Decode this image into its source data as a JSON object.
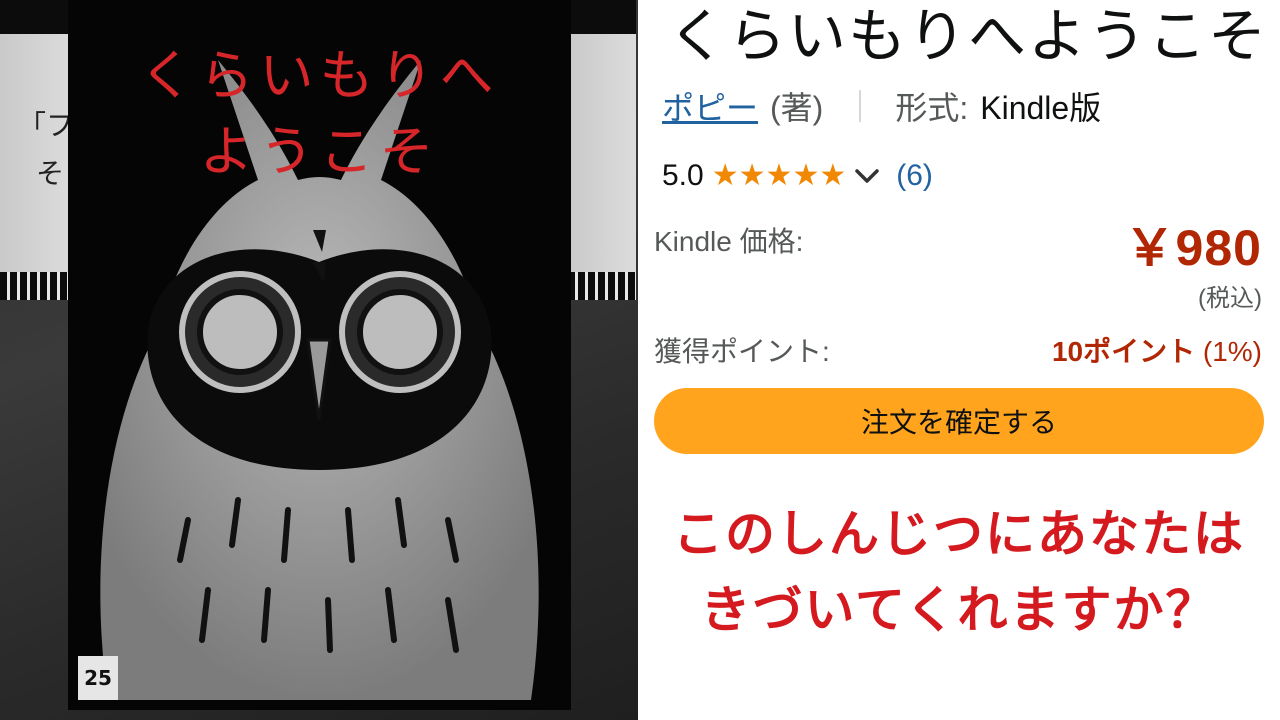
{
  "background": {
    "left_card_text_1": "「フ",
    "left_card_text_2": "そ"
  },
  "cover": {
    "title_line1": "くらいもりへ",
    "title_line2": "ようこそ",
    "page_number": "25"
  },
  "product": {
    "title": "くらいもりへようこそ",
    "author": "ポピー",
    "author_role": "(著)",
    "format_label": "形式:",
    "format_value": "Kindle版",
    "rating_value": "5.0",
    "stars": 5,
    "rating_count": "(6)",
    "price_label": "Kindle 価格:",
    "price_value": "￥980",
    "tax_note": "(税込)",
    "points_label": "獲得ポイント:",
    "points_amount": "10ポイント",
    "points_percent": "(1%)",
    "order_button": "注文を確定する"
  },
  "caption": {
    "line1": "このしんじつにあなたは",
    "line2": "きづいてくれますか？"
  },
  "colors": {
    "title_red": "#d7262a",
    "price_red": "#b12704",
    "link_blue": "#2162a1",
    "star_orange": "#f08804",
    "button_orange": "#ffa41c",
    "caption_red": "#d4191f"
  },
  "icons": {
    "star": "star-icon",
    "chevron": "chevron-down-icon"
  }
}
